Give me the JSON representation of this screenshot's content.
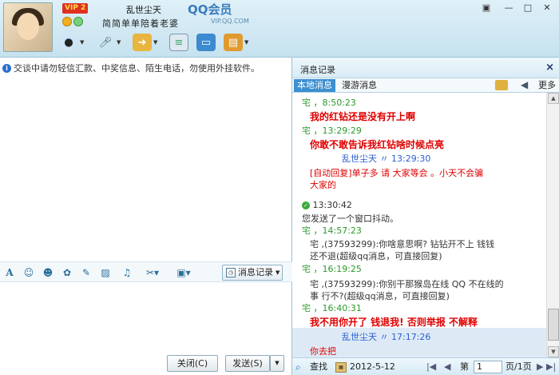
{
  "header": {
    "vip_badge": "VIP 2",
    "nickname": "乱世尘天",
    "signature": "简简单单陪着老婆",
    "brand": "QQ会员",
    "brand_sub": "VIP.QQ.COM",
    "window_controls": [
      "pin-icon",
      "minimize-icon",
      "maximize-icon",
      "close-icon"
    ],
    "toolbar_icons": [
      "camera-icon",
      "microphone-icon",
      "file-transfer-icon",
      "sms-icon",
      "remote-desktop-icon",
      "app-icon"
    ]
  },
  "left": {
    "notice": "交谈中请勿轻信汇款、中奖信息、陌生电话，勿使用外挂软件。",
    "format_icons": [
      "font-icon",
      "emoji-icon",
      "magic-face-icon",
      "gift-icon",
      "doodle-icon",
      "image-icon",
      "music-icon",
      "screenshot-icon",
      "more-app-icon"
    ],
    "history_button": "消息记录",
    "close_button": "关闭(C)",
    "send_button": "发送(S)"
  },
  "right": {
    "title": "消息记录",
    "tabs": [
      "本地消息",
      "漫游消息"
    ],
    "more_label": "更多",
    "messages": [
      {
        "header": "宅    ，8:50:23",
        "color": "green",
        "text": "我的红钻还是没有开上啊",
        "style": "red"
      },
      {
        "header": "宅    ，13:29:29",
        "color": "green",
        "text": "你敢不敢告诉我红钻啥时候点亮",
        "style": "red"
      },
      {
        "header": "乱世尘天    〃    13:29:30",
        "color": "blue",
        "text": "[自动回复]单子多 请 大家等会 。小天不会骗",
        "text2": "大家的",
        "style": "auto"
      },
      {
        "header": "13:30:42",
        "color": "sys",
        "text": "您发送了一个窗口抖动。",
        "style": "sys"
      },
      {
        "header": "宅    ，14:57:23",
        "color": "green",
        "text": "宅    ,(37593299):你啥意思啊? 钻钻开不上  钱钱",
        "text2": "还不退(超级qq消息，可直接回复)",
        "style": "sys"
      },
      {
        "header": "宅    ，16:19:25",
        "color": "green",
        "text": "宅    ,(37593299):你别干那猴岛在线 QQ 不在线的",
        "text2": "事 行不?(超级qq消息，可直接回复)",
        "style": "sys"
      },
      {
        "header": "宅    ，16:40:31",
        "color": "green",
        "text": "我不用你开了  钱退我!  否则举报  不解释",
        "style": "red"
      },
      {
        "header": "乱世尘天    〃    17:17:26",
        "color": "blue",
        "text": "你去把",
        "style": "auto"
      }
    ],
    "footer": {
      "search_label": "查找",
      "date": "2012-5-12",
      "page_prefix": "第",
      "page_value": "1",
      "page_suffix": "页/1页"
    }
  }
}
